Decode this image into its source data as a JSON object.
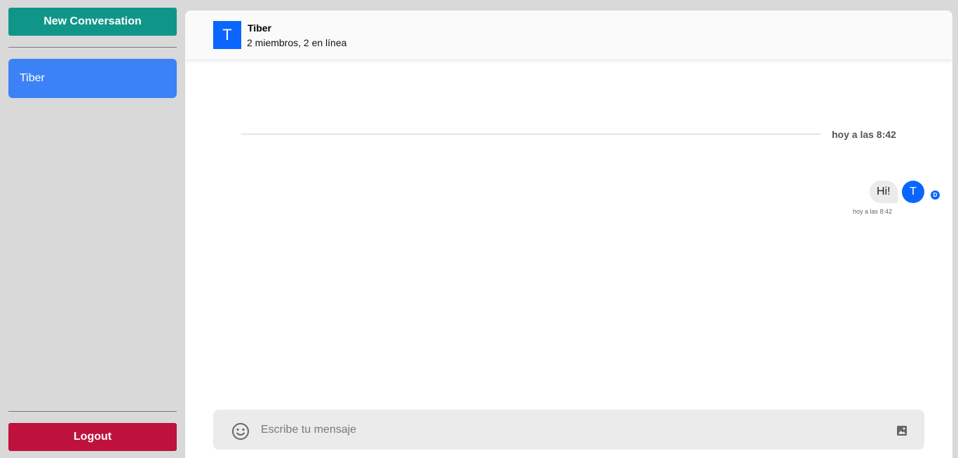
{
  "sidebar": {
    "new_conversation_label": "New Conversation",
    "conversations": [
      {
        "label": "Tiber"
      }
    ],
    "logout_label": "Logout"
  },
  "header": {
    "avatar_initial": "T",
    "title": "Tiber",
    "subtitle": "2 miembros, 2 en línea"
  },
  "messages": {
    "date_divider": "hoy a las 8:42",
    "items": [
      {
        "text": "Hi!",
        "avatar_initial": "T",
        "badge": "D",
        "time": "hoy a las 8:42"
      }
    ]
  },
  "composer": {
    "placeholder": "Escribe tu mensaje",
    "emoji_icon": "emoji-smile-icon",
    "image_icon": "image-icon"
  },
  "colors": {
    "new_conversation": "#0f9688",
    "active_conversation": "#3b82f6",
    "logout": "#be123c",
    "avatar": "#0a66ff"
  }
}
